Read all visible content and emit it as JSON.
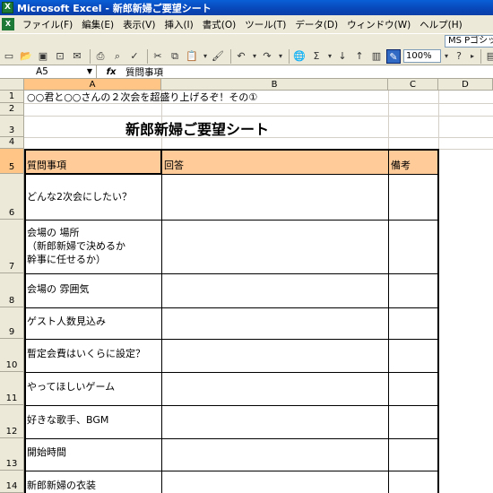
{
  "window": {
    "title": "Microsoft Excel - 新郎新婦ご要望シート",
    "app_icon": "X"
  },
  "menu": [
    "ファイル(F)",
    "編集(E)",
    "表示(V)",
    "挿入(I)",
    "書式(O)",
    "ツール(T)",
    "データ(D)",
    "ウィンドウ(W)",
    "ヘルプ(H)"
  ],
  "toolbar": {
    "font_name": "MS Pゴシック",
    "zoom": "100%"
  },
  "formula_bar": {
    "name_box": "A5",
    "fx": "fx",
    "content": "質問事項"
  },
  "columns": [
    "A",
    "B",
    "C",
    "D"
  ],
  "rows": [
    "1",
    "2",
    "3",
    "4",
    "5",
    "6",
    "7",
    "8",
    "9",
    "10",
    "11",
    "12",
    "13",
    "14"
  ],
  "sheet": {
    "a1": "○○君と○○さんの２次会を超盛り上げるぞ！その①",
    "title": "新郎新婦ご要望シート",
    "headers": {
      "question": "質問事項",
      "answer": "回答",
      "notes": "備考"
    },
    "questions": [
      [
        "どんな2次会にしたい？"
      ],
      [
        "会場の 場所",
        "（新郎新婦で決めるか",
        "幹事に任せるか）"
      ],
      [
        "会場の 雰囲気"
      ],
      [
        "ゲスト人数見込み"
      ],
      [
        "暫定会費はいくらに設定？"
      ],
      [
        "やってほしいゲーム"
      ],
      [
        "好きな歌手、BGM"
      ],
      [
        "開始時間"
      ],
      [
        "新郎新婦の衣装"
      ]
    ]
  },
  "colors": {
    "header_fill": "#ffcc99",
    "selected_header": "#ffc586",
    "titlebar": "#0a5fd6"
  }
}
